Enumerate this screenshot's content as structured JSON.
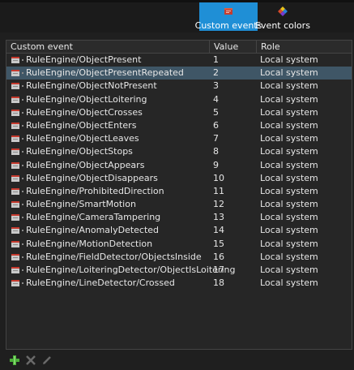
{
  "tabs": [
    {
      "label": "Custom events",
      "icon": "custom-events-icon",
      "active": true
    },
    {
      "label": "Event colors",
      "icon": "event-colors-icon",
      "active": false
    }
  ],
  "columns": {
    "event": "Custom event",
    "value": "Value",
    "role": "Role"
  },
  "rows": [
    {
      "event": "RuleEngine/ObjectPresent",
      "value": "1",
      "role": "Local system"
    },
    {
      "event": "RuleEngine/ObjectPresentRepeated",
      "value": "2",
      "role": "Local system"
    },
    {
      "event": "RuleEngine/ObjectNotPresent",
      "value": "3",
      "role": "Local system"
    },
    {
      "event": "RuleEngine/ObjectLoitering",
      "value": "4",
      "role": "Local system"
    },
    {
      "event": "RuleEngine/ObjectCrosses",
      "value": "5",
      "role": "Local system"
    },
    {
      "event": "RuleEngine/ObjectEnters",
      "value": "6",
      "role": "Local system"
    },
    {
      "event": "RuleEngine/ObjectLeaves",
      "value": "7",
      "role": "Local system"
    },
    {
      "event": "RuleEngine/ObjectStops",
      "value": "8",
      "role": "Local system"
    },
    {
      "event": "RuleEngine/ObjectAppears",
      "value": "9",
      "role": "Local system"
    },
    {
      "event": "RuleEngine/ObjectDisappears",
      "value": "10",
      "role": "Local system"
    },
    {
      "event": "RuleEngine/ProhibitedDirection",
      "value": "11",
      "role": "Local system"
    },
    {
      "event": "RuleEngine/SmartMotion",
      "value": "12",
      "role": "Local system"
    },
    {
      "event": "RuleEngine/CameraTampering",
      "value": "13",
      "role": "Local system"
    },
    {
      "event": "RuleEngine/AnomalyDetected",
      "value": "14",
      "role": "Local system"
    },
    {
      "event": "RuleEngine/MotionDetection",
      "value": "15",
      "role": "Local system"
    },
    {
      "event": "RuleEngine/FieldDetector/ObjectsInside",
      "value": "16",
      "role": "Local system"
    },
    {
      "event": "RuleEngine/LoiteringDetector/ObjectIsLoitering",
      "value": "17",
      "role": "Local system"
    },
    {
      "event": "RuleEngine/LineDetector/Crossed",
      "value": "18",
      "role": "Local system"
    }
  ],
  "selected_row": 1,
  "toolbar": {
    "add": {
      "icon": "add-icon",
      "enabled": true
    },
    "delete": {
      "icon": "delete-icon",
      "enabled": false
    },
    "edit": {
      "icon": "edit-icon",
      "enabled": false
    }
  },
  "colors": {
    "accent": "#1f8fd6",
    "selected_row": "#3f5666",
    "add_green": "#4caf3a"
  }
}
